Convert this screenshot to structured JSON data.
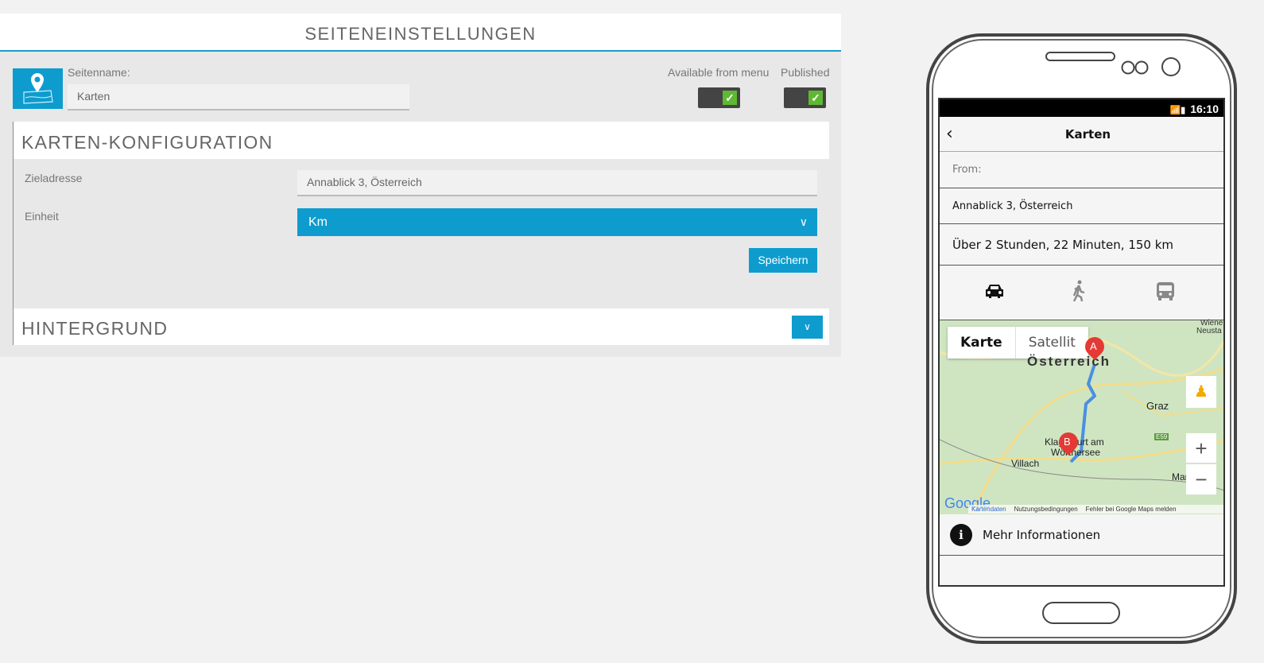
{
  "settings": {
    "title": "SEITENEINSTELLUNGEN",
    "page_name_label": "Seitenname:",
    "page_name_value": "Karten",
    "available_label": "Available from menu",
    "published_label": "Published",
    "available": true,
    "published": true
  },
  "map_config": {
    "title": "KARTEN-KONFIGURATION",
    "address_label": "Zieladresse",
    "address_value": "Annablick 3, Österreich",
    "unit_label": "Einheit",
    "unit_value": "Km",
    "save_label": "Speichern"
  },
  "background": {
    "title": "HINTERGRUND"
  },
  "phone": {
    "time": "16:10",
    "title": "Karten",
    "from_placeholder": "From:",
    "destination": "Annablick 3, Österreich",
    "route_summary": "Über 2 Stunden, 22 Minuten, 150 km",
    "modes": [
      "car-icon",
      "walk-icon",
      "bus-icon"
    ],
    "map": {
      "tab_map": "Karte",
      "tab_satellite": "Satellit",
      "labels": {
        "country": "Österreich",
        "graz": "Graz",
        "klagenfurt1": "Klagenfurt am",
        "klagenfurt2": "Wörthersee",
        "villach": "Villach",
        "maribor": "Maribor",
        "wien": "Wiene",
        "neusta": "Neusta",
        "e59": "E59"
      },
      "marker_a": "A",
      "marker_b": "B",
      "footer": [
        "Kartendaten",
        "Nutzungsbedingungen",
        "Fehler bei Google Maps melden"
      ],
      "logo": "Google"
    },
    "more_info": "Mehr Informationen"
  },
  "colors": {
    "accent": "#0e9ccf",
    "toggle_on": "#5fb833",
    "route": "#4a90e2",
    "marker": "#e53935"
  }
}
